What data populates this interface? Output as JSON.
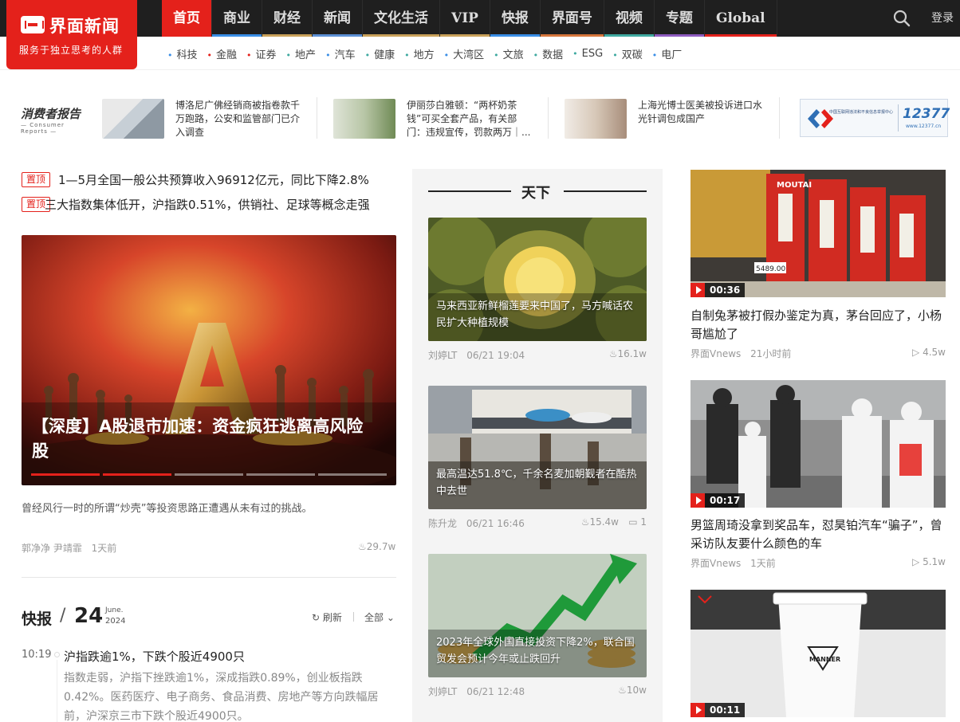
{
  "brand": {
    "name": "界面新闻",
    "slogan": "服务于独立思考的人群",
    "color": "#e4211b"
  },
  "nav": [
    {
      "label": "首页",
      "color": "#e4211b",
      "active": true
    },
    {
      "label": "商业",
      "color": "#3a8ee6"
    },
    {
      "label": "财经",
      "color": "#c9a15a"
    },
    {
      "label": "新闻",
      "color": "#5b8fd4"
    },
    {
      "label": "文化生活",
      "color": "#c9a15a"
    },
    {
      "label": "VIP",
      "color": "#c9a15a"
    },
    {
      "label": "快报",
      "color": "#3a8ee6"
    },
    {
      "label": "界面号",
      "color": "#d6763c"
    },
    {
      "label": "视频",
      "color": "#3fa9a0"
    },
    {
      "label": "专题",
      "color": "#8e5bbf"
    },
    {
      "label": "Global",
      "color": "#e4211b"
    }
  ],
  "login": "登录",
  "subnav": [
    {
      "label": "科技",
      "color": "#3a8ee6"
    },
    {
      "label": "金融",
      "color": "#e4211b"
    },
    {
      "label": "证券",
      "color": "#e4211b"
    },
    {
      "label": "地产",
      "color": "#3fa9a0"
    },
    {
      "label": "汽车",
      "color": "#3a8ee6"
    },
    {
      "label": "健康",
      "color": "#3fa9a0"
    },
    {
      "label": "地方",
      "color": "#3fa9a0"
    },
    {
      "label": "大湾区",
      "color": "#3a8ee6"
    },
    {
      "label": "文旅",
      "color": "#3fa9a0"
    },
    {
      "label": "数据",
      "color": "#3fa9a0"
    },
    {
      "label": "ESG",
      "color": "#3fa9a0"
    },
    {
      "label": "双碳",
      "color": "#3fa9a0"
    },
    {
      "label": "电厂",
      "color": "#3a8ee6"
    }
  ],
  "consumer_report": {
    "title": "消费者报告",
    "sub": "— Consumer Reports —"
  },
  "ads": [
    {
      "text": "博洛尼广佛经销商被指卷款千万跑路，公安和监管部门已介入调查"
    },
    {
      "text": "伊丽莎白雅顿：“两杯奶茶钱”可买全套产品，有关部门：违规宣传，罚款两万｜..."
    },
    {
      "text": "上海光博士医美被投诉进口水光针调包成国产"
    }
  ],
  "banner": {
    "brand": "中国互联网违法和不良信息举报中心",
    "number": "12377",
    "url_text": "www.12377.cn"
  },
  "tickers": [
    {
      "tag": "置顶",
      "text": "1—5月全国一般公共预算收入96912亿元，同比下降2.8%"
    },
    {
      "tag": "置顶",
      "text": "三大指数集体低开，沪指跌0.51%，供销社、足球等概念走强"
    }
  ],
  "hero": {
    "title": "【深度】A股退市加速：资金疯狂逃离高风险股",
    "desc": "曾经风行一时的所谓“炒壳”等投资思路正遭遇从未有过的挑战。",
    "authors": "郭净净 尹靖霏",
    "time": "1天前",
    "views": "29.7w",
    "glyph": "A"
  },
  "kuaibao": {
    "title": "快报",
    "day": "24",
    "month": "June.",
    "year": "2024",
    "refresh": "刷新",
    "filter": "全部"
  },
  "flash": {
    "time": "10:19",
    "title": "沪指跌逾1%，下跌个股近4900只",
    "body": "指数走弱，沪指下挫跌逾1%，深成指跌0.89%，创业板指跌0.42%。医药医疗、电子商务、食品消费、房地产等方向跌幅居前，沪深京三市下跌个股近4900只。"
  },
  "tianxia": {
    "title": "天下",
    "cards": [
      {
        "caption": "马来西亚新鲜榴莲要来中国了，马方喊话农民扩大种植规模",
        "author": "刘婷LT",
        "date": "06/21 19:04",
        "views": "16.1w",
        "comments": ""
      },
      {
        "caption": "最高温达51.8℃，千余名麦加朝觐者在酷热中去世",
        "author": "陈升龙",
        "date": "06/21 16:46",
        "views": "15.4w",
        "comments": "1"
      },
      {
        "caption": "2023年全球外国直接投资下降2%，联合国贸发会预计今年或止跌回升",
        "author": "刘婷LT",
        "date": "06/21 12:48",
        "views": "10w",
        "comments": ""
      }
    ]
  },
  "videos": [
    {
      "duration": "00:36",
      "title": "自制兔茅被打假办鉴定为真，茅台回应了，小杨哥尴尬了",
      "source": "界面Vnews",
      "time": "21小时前",
      "plays": "4.5w",
      "label_text": "MOUTAI",
      "price": "5489.00"
    },
    {
      "duration": "00:17",
      "title": "男篮周琦没拿到奖品车，怼昊铂汽车“骗子”，曾采访队友要什么颜色的车",
      "source": "界面Vnews",
      "time": "1天前",
      "plays": "5.1w"
    },
    {
      "duration": "00:11",
      "cup_text": "MANNER"
    }
  ]
}
